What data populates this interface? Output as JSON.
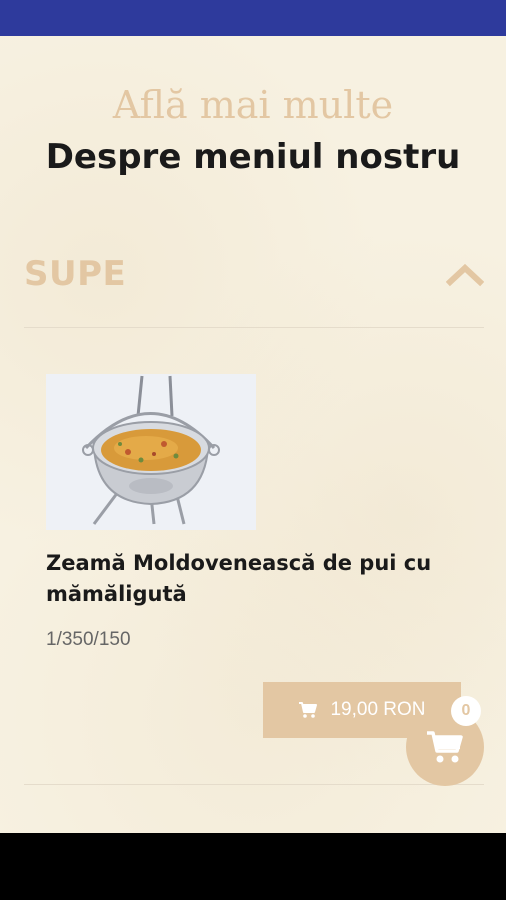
{
  "header": {
    "subtitle": "Află mai multe",
    "title": "Despre meniul nostru"
  },
  "section": {
    "title": "SUPE",
    "toggle_icon": "chevron-up-icon",
    "expanded": true
  },
  "product": {
    "name": "Zeamă Moldovenească de pui cu mămăligută",
    "portion": "1/350/150",
    "price": "19,00 RON",
    "price_icon": "cart-icon"
  },
  "cart": {
    "icon": "cart-icon",
    "count": "0"
  },
  "colors": {
    "status_bar": "#2e3a9c",
    "background": "#f7f1e1",
    "accent": "#e3c7a3",
    "text": "#1a1a1a"
  }
}
